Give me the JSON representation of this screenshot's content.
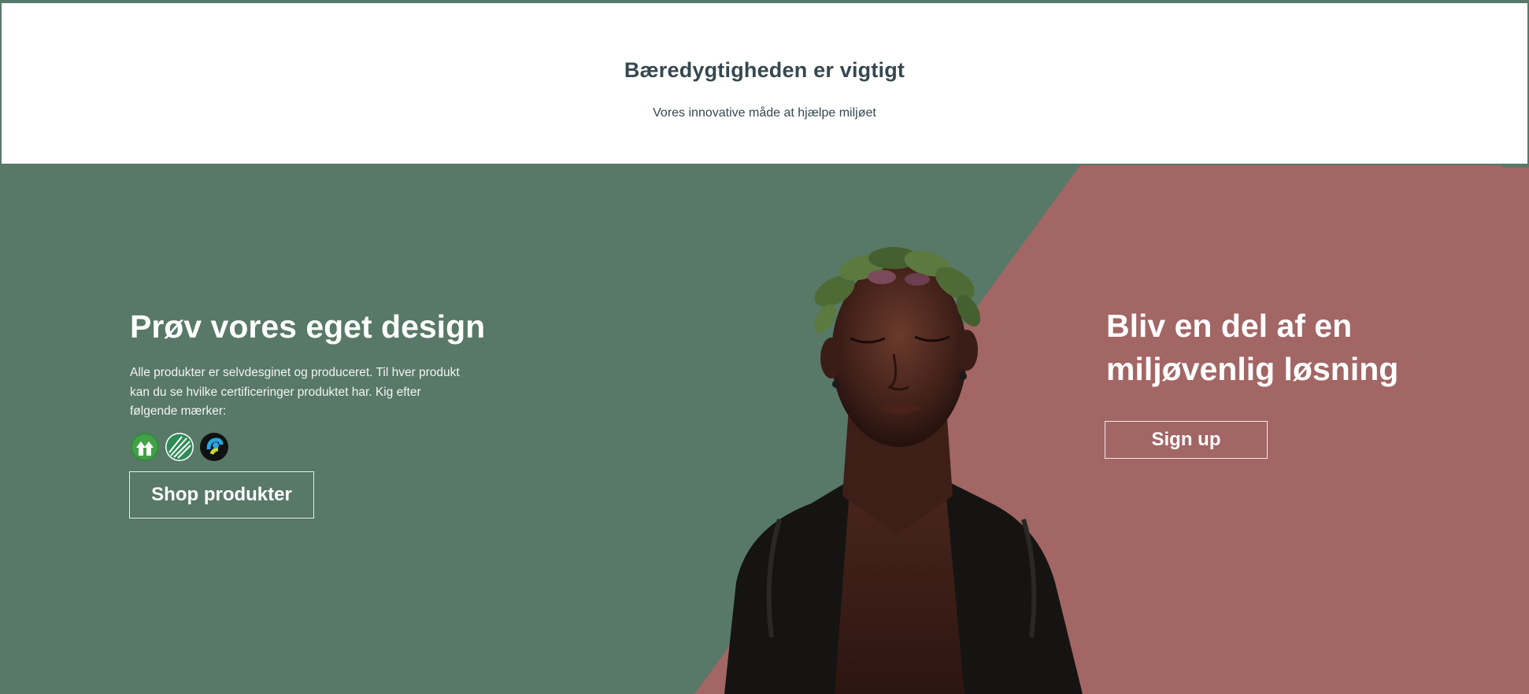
{
  "intro": {
    "title": "Bæredygtigheden er vigtigt",
    "subtitle": "Vores innovative måde at hjælpe miljøet"
  },
  "hero_left": {
    "title": "Prøv vores eget design",
    "body": "Alle produkter er selvdesginet og produceret. Til hver produkt kan du se hvilke certificeringer produktet har. Kig efter følgende mærker:",
    "certifications": [
      {
        "icon": "gots-organic-icon"
      },
      {
        "icon": "nordic-swan-ecolabel-icon"
      },
      {
        "icon": "fairtrade-icon"
      }
    ],
    "button_label": "Shop produkter"
  },
  "hero_right": {
    "title": "Bliv en del af en miljøvenlig løsning",
    "button_label": "Sign up"
  },
  "colors": {
    "green": "#587868",
    "rose": "#a26664",
    "heading_dark": "#36484f"
  }
}
